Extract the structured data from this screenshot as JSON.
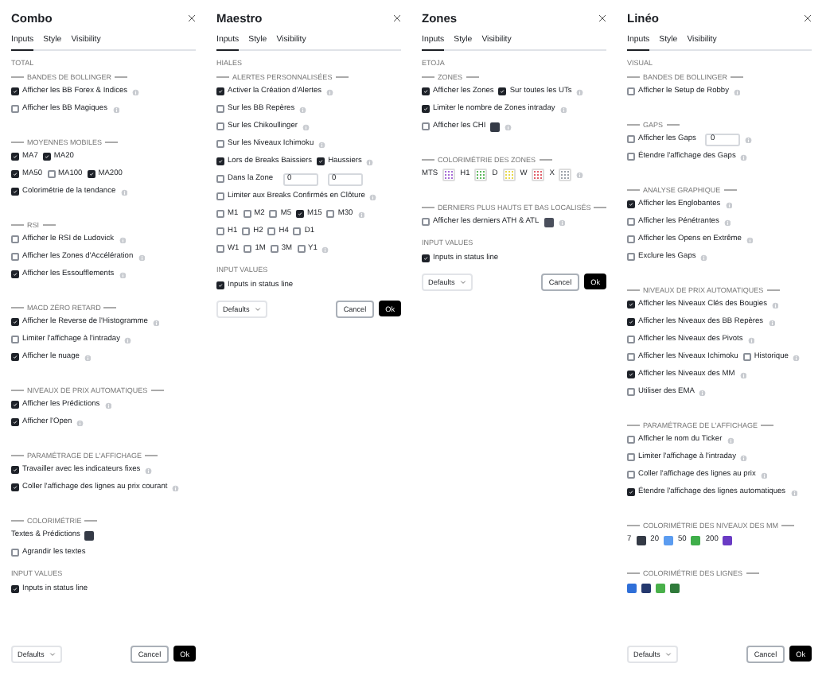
{
  "panels": [
    {
      "title": "Combo",
      "tabs": [
        {
          "label": "Inputs",
          "selected": true
        },
        {
          "label": "Style",
          "selected": false
        },
        {
          "label": "Visibility",
          "selected": false
        }
      ],
      "rows": [
        {
          "kind": "caption",
          "text": "TOTAL"
        },
        {
          "kind": "section",
          "text": "BANDES DE BOLLINGER"
        },
        {
          "kind": "check",
          "items": [
            {
              "label": "Afficher les BB Forex & Indices",
              "checked": true
            }
          ],
          "info": true
        },
        {
          "kind": "check",
          "items": [
            {
              "label": "Afficher les BB Magiques",
              "checked": false
            }
          ],
          "info": true
        },
        {
          "kind": "section",
          "text": "MOYENNES MOBILES"
        },
        {
          "kind": "check",
          "items": [
            {
              "label": "MA7",
              "checked": true
            },
            {
              "label": "MA20",
              "checked": true
            }
          ]
        },
        {
          "kind": "check",
          "items": [
            {
              "label": "MA50",
              "checked": true
            },
            {
              "label": "MA100",
              "checked": false
            },
            {
              "label": "MA200",
              "checked": true
            }
          ]
        },
        {
          "kind": "check",
          "items": [
            {
              "label": "Colorimétrie de la tendance",
              "checked": true
            }
          ],
          "info": true
        },
        {
          "kind": "section",
          "text": "RSI"
        },
        {
          "kind": "check",
          "items": [
            {
              "label": "Afficher le RSI de Ludovick",
              "checked": false
            }
          ],
          "info": true
        },
        {
          "kind": "check",
          "items": [
            {
              "label": "Afficher les Zones d'Accélération",
              "checked": false
            }
          ],
          "info": true
        },
        {
          "kind": "check",
          "items": [
            {
              "label": "Afficher les Essoufflements",
              "checked": true
            }
          ],
          "info": true
        },
        {
          "kind": "section",
          "text": "MACD ZÉRO RETARD"
        },
        {
          "kind": "check",
          "items": [
            {
              "label": "Afficher le Reverse de l'Histogramme",
              "checked": true
            }
          ],
          "info": true
        },
        {
          "kind": "check",
          "items": [
            {
              "label": "Limiter l'affichage à l'intraday",
              "checked": false
            }
          ],
          "info": true
        },
        {
          "kind": "check",
          "items": [
            {
              "label": "Afficher le nuage",
              "checked": true
            }
          ],
          "info": true
        },
        {
          "kind": "section",
          "text": "NIVEAUX DE PRIX AUTOMATIQUES"
        },
        {
          "kind": "check",
          "items": [
            {
              "label": "Afficher les Prédictions",
              "checked": true
            }
          ],
          "info": true
        },
        {
          "kind": "check",
          "items": [
            {
              "label": "Afficher l'Open",
              "checked": true
            }
          ],
          "info": true
        },
        {
          "kind": "section",
          "text": "PARAMÉTRAGE DE L'AFFICHAGE"
        },
        {
          "kind": "check",
          "items": [
            {
              "label": "Travailler avec les indicateurs fixes",
              "checked": true
            }
          ],
          "info": true
        },
        {
          "kind": "check",
          "items": [
            {
              "label": "Coller l'affichage des lignes au prix courant",
              "checked": true
            }
          ],
          "info": true
        },
        {
          "kind": "section",
          "text": "COLORIMÉTRIE"
        },
        {
          "kind": "text",
          "text": "Textes & Prédictions",
          "color": "#343a46"
        },
        {
          "kind": "check",
          "items": [
            {
              "label": "Agrandir les textes",
              "checked": false
            }
          ]
        },
        {
          "kind": "caption",
          "text": "INPUT VALUES"
        },
        {
          "kind": "check",
          "items": [
            {
              "label": "Inputs in status line",
              "checked": true
            }
          ]
        }
      ],
      "footer": {
        "defaults": "Defaults",
        "cancel": "Cancel",
        "ok": "Ok"
      }
    },
    {
      "title": "Maestro",
      "tabs": [
        {
          "label": "Inputs",
          "selected": true
        },
        {
          "label": "Style",
          "selected": false
        },
        {
          "label": "Visibility",
          "selected": false
        }
      ],
      "rows": [
        {
          "kind": "caption",
          "text": "HIALES"
        },
        {
          "kind": "section",
          "text": "ALERTES PERSONNALISÉES"
        },
        {
          "kind": "check",
          "items": [
            {
              "label": "Activer la Création d'Alertes",
              "checked": true
            }
          ],
          "info": true
        },
        {
          "kind": "check",
          "items": [
            {
              "label": "Sur les BB Repères",
              "checked": false
            }
          ],
          "info": true
        },
        {
          "kind": "check",
          "items": [
            {
              "label": "Sur les Chikoullinger",
              "checked": false
            }
          ],
          "info": true
        },
        {
          "kind": "check",
          "items": [
            {
              "label": "Sur les Niveaux Ichimoku",
              "checked": false
            }
          ],
          "info": true
        },
        {
          "kind": "check",
          "items": [
            {
              "label": "Lors de Breaks Baissiers",
              "checked": true
            },
            {
              "label": "Haussiers",
              "checked": true
            }
          ],
          "info": true
        },
        {
          "kind": "check",
          "items": [
            {
              "label": "Dans la Zone",
              "checked": false
            }
          ],
          "fields": [
            "0",
            "0"
          ]
        },
        {
          "kind": "check",
          "items": [
            {
              "label": "Limiter aux Breaks Confirmés en Clôture",
              "checked": false
            }
          ],
          "info": true
        },
        {
          "kind": "check",
          "items": [
            {
              "label": "M1",
              "checked": false
            },
            {
              "label": "M2",
              "checked": false
            },
            {
              "label": "M5",
              "checked": false
            },
            {
              "label": "M15",
              "checked": true
            },
            {
              "label": "M30",
              "checked": false
            }
          ],
          "info": true
        },
        {
          "kind": "check",
          "items": [
            {
              "label": "H1",
              "checked": false
            },
            {
              "label": "H2",
              "checked": false
            },
            {
              "label": "H4",
              "checked": false
            },
            {
              "label": "D1",
              "checked": false
            }
          ]
        },
        {
          "kind": "check",
          "items": [
            {
              "label": "W1",
              "checked": false
            },
            {
              "label": "1M",
              "checked": false
            },
            {
              "label": "3M",
              "checked": false
            },
            {
              "label": "Y1",
              "checked": false
            }
          ],
          "info": true
        },
        {
          "kind": "caption",
          "text": "INPUT VALUES"
        },
        {
          "kind": "check",
          "items": [
            {
              "label": "Inputs in status line",
              "checked": true
            }
          ]
        }
      ],
      "footer": {
        "defaults": "Defaults",
        "cancel": "Cancel",
        "ok": "Ok"
      }
    },
    {
      "title": "Zones",
      "tabs": [
        {
          "label": "Inputs",
          "selected": true
        },
        {
          "label": "Style",
          "selected": false
        },
        {
          "label": "Visibility",
          "selected": false
        }
      ],
      "rows": [
        {
          "kind": "caption",
          "text": "ETOJA"
        },
        {
          "kind": "section",
          "text": "ZONES"
        },
        {
          "kind": "check",
          "items": [
            {
              "label": "Afficher les Zones",
              "checked": true
            },
            {
              "label": "Sur toutes les UTs",
              "checked": true
            }
          ],
          "info": true
        },
        {
          "kind": "check",
          "items": [
            {
              "label": "Limiter le nombre de Zones intraday",
              "checked": true
            }
          ],
          "info": true
        },
        {
          "kind": "check",
          "items": [
            {
              "label": "Afficher les CHI",
              "checked": false
            }
          ],
          "color": "#343a46",
          "info": true
        },
        {
          "kind": "section",
          "text": "COLORIMÉTRIE DES ZONES"
        },
        {
          "kind": "palette",
          "pattern": true,
          "items": [
            {
              "label": "MTS",
              "color": "#a56bd6"
            },
            {
              "label": "H1",
              "color": "#5cb85c"
            },
            {
              "label": "D",
              "color": "#e8d84a"
            },
            {
              "label": "W",
              "color": "#e0606a"
            },
            {
              "label": "X",
              "color": "#9aa0a8"
            }
          ],
          "info": true
        },
        {
          "kind": "section",
          "text": "DERNIERS PLUS HAUTS ET BAS LOCALISÉS"
        },
        {
          "kind": "check",
          "items": [
            {
              "label": "Afficher les derniers ATH & ATL",
              "checked": false
            }
          ],
          "color": "#4a4f5c",
          "info": true
        },
        {
          "kind": "caption",
          "text": "INPUT VALUES"
        },
        {
          "kind": "check",
          "items": [
            {
              "label": "Inputs in status line",
              "checked": true
            }
          ]
        }
      ],
      "footer": {
        "defaults": "Defaults",
        "cancel": "Cancel",
        "ok": "Ok"
      }
    },
    {
      "title": "Linéo",
      "tabs": [
        {
          "label": "Inputs",
          "selected": true
        },
        {
          "label": "Style",
          "selected": false
        },
        {
          "label": "Visibility",
          "selected": false
        }
      ],
      "rows": [
        {
          "kind": "caption",
          "text": "VISUAL"
        },
        {
          "kind": "section",
          "text": "BANDES DE BOLLINGER"
        },
        {
          "kind": "check",
          "items": [
            {
              "label": "Afficher le Setup de Robby",
              "checked": false
            }
          ],
          "info": true
        },
        {
          "kind": "section",
          "text": "GAPS"
        },
        {
          "kind": "check",
          "items": [
            {
              "label": "Afficher les Gaps",
              "checked": false
            }
          ],
          "fields": [
            "0"
          ],
          "info": true
        },
        {
          "kind": "check",
          "items": [
            {
              "label": "Étendre l'affichage des Gaps",
              "checked": false
            }
          ],
          "info": true
        },
        {
          "kind": "section",
          "text": "ANALYSE GRAPHIQUE"
        },
        {
          "kind": "check",
          "items": [
            {
              "label": "Afficher les Englobantes",
              "checked": true
            }
          ],
          "info": true
        },
        {
          "kind": "check",
          "items": [
            {
              "label": "Afficher les Pénétrantes",
              "checked": false
            }
          ],
          "info": true
        },
        {
          "kind": "check",
          "items": [
            {
              "label": "Afficher les Opens en Extrême",
              "checked": false
            }
          ],
          "info": true
        },
        {
          "kind": "check",
          "items": [
            {
              "label": "Exclure les Gaps",
              "checked": false
            }
          ],
          "info": true
        },
        {
          "kind": "section",
          "text": "NIVEAUX DE PRIX AUTOMATIQUES"
        },
        {
          "kind": "check",
          "items": [
            {
              "label": "Afficher les Niveaux Clés des Bougies",
              "checked": true
            }
          ],
          "info": true
        },
        {
          "kind": "check",
          "items": [
            {
              "label": "Afficher les Niveaux des BB Repères",
              "checked": true
            }
          ],
          "info": true
        },
        {
          "kind": "check",
          "items": [
            {
              "label": "Afficher les Niveaux des Pivots",
              "checked": false
            }
          ],
          "info": true
        },
        {
          "kind": "check",
          "items": [
            {
              "label": "Afficher les Niveaux Ichimoku",
              "checked": false
            },
            {
              "label": "Historique",
              "checked": false
            }
          ],
          "info": true
        },
        {
          "kind": "check",
          "items": [
            {
              "label": "Afficher les Niveaux des MM",
              "checked": true
            }
          ],
          "info": true
        },
        {
          "kind": "check",
          "items": [
            {
              "label": "Utiliser des EMA",
              "checked": false
            }
          ],
          "info": true
        },
        {
          "kind": "section",
          "text": "PARAMÉTRAGE DE L'AFFICHAGE"
        },
        {
          "kind": "check",
          "items": [
            {
              "label": "Afficher le nom du Ticker",
              "checked": false
            }
          ],
          "info": true
        },
        {
          "kind": "check",
          "items": [
            {
              "label": "Limiter l'affichage à l'intraday",
              "checked": false
            }
          ],
          "info": true
        },
        {
          "kind": "check",
          "items": [
            {
              "label": "Coller l'affichage des lignes au prix",
              "checked": false
            }
          ],
          "info": true
        },
        {
          "kind": "check",
          "items": [
            {
              "label": "Étendre l'affichage des lignes automatiques",
              "checked": true
            }
          ],
          "info": true
        },
        {
          "kind": "section",
          "text": "COLORIMÉTRIE DES NIVEAUX DES MM"
        },
        {
          "kind": "palette",
          "pattern": false,
          "items": [
            {
              "label": "7",
              "color": "#343a46"
            },
            {
              "label": "20",
              "color": "#5b9cf0"
            },
            {
              "label": "50",
              "color": "#3fae4a"
            },
            {
              "label": "200",
              "color": "#6a3bc4"
            }
          ]
        },
        {
          "kind": "section",
          "text": "COLORIMÉTRIE DES LIGNES"
        },
        {
          "kind": "palette",
          "pattern": false,
          "items": [
            {
              "color": "#2f6fd8"
            },
            {
              "color": "#24386e"
            },
            {
              "color": "#49b04a"
            },
            {
              "color": "#2f7a3a"
            }
          ]
        }
      ],
      "footer": {
        "defaults": "Defaults",
        "cancel": "Cancel",
        "ok": "Ok"
      }
    }
  ]
}
